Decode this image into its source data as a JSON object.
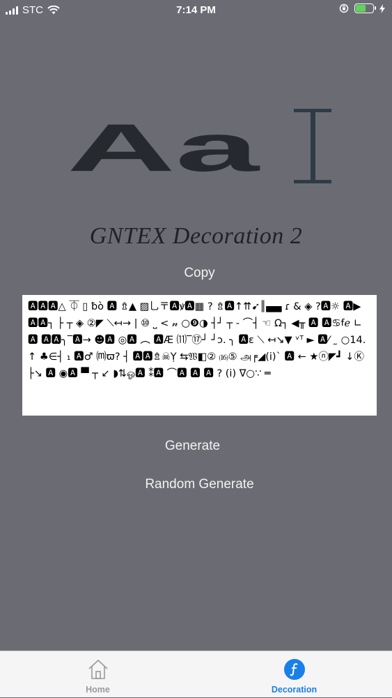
{
  "status_bar": {
    "carrier": "STC",
    "time": "7:14 PM",
    "battery_level": 0.6,
    "battery_color": "#5fd35a"
  },
  "logo": {
    "text": "Aa"
  },
  "title": "GNTEX Decoration 2",
  "buttons": {
    "copy": "Copy",
    "generate": "Generate",
    "random_generate": "Random Generate"
  },
  "decorated_text": "🅰🅰🅰△ ⏁ ▯ ƀò 🅰 ⇯▲ ▨乚〒🅰ꝟ🅰▦ ? ⇯🅰↑⇈➹║▄▄ ɾ & ◈ ?🅰☼ 🅰▶🅰🅰┐ ├ ┬ ◈ ②◤ ⟍↤→ | ⑩ ⎵ < 𝓃 ○❾◑ ┤┘ ┬ - ⌒┤ ☜ Ω┐ ◀╥ 🅰 🅰♋︎ꬵℯ ∟ 🅰 🅰🅰╮‾🅰→ ☻🅰 ◎🅰 ︵ 🅰Æ ⑾‾⑰┘ ┘ɔ. ╮ 🅰ε ⟍ ↤↘▼ ᵛᵀ ► 🅰⁄ ˷ ○14. ↑ ♣∈┤ ₁ 🅰♂ ⒨ϖ? ┤ 🅰🅰⇯☠Ỵ ⇆𝔚◧② ⒃⑤ அ╒◢(i)` 🅰 ← ★ⓝ◤┛ ↓Ⓚ ├↘ 🅰 ◉🅰 ▀ ┬ ↙ ◗⇅ஓ🅰 ⁑🅰 ⌒🅰 🅰 🅰 ? (i) ∇○∵ ═",
  "tabs": [
    {
      "label": "Home",
      "icon": "home-icon",
      "active": false
    },
    {
      "label": "Decoration",
      "icon": "decoration-icon",
      "active": true
    }
  ],
  "colors": {
    "background": "#6b6c73",
    "accent": "#1a7fe8",
    "inactive_tab": "#9a9a9e"
  }
}
